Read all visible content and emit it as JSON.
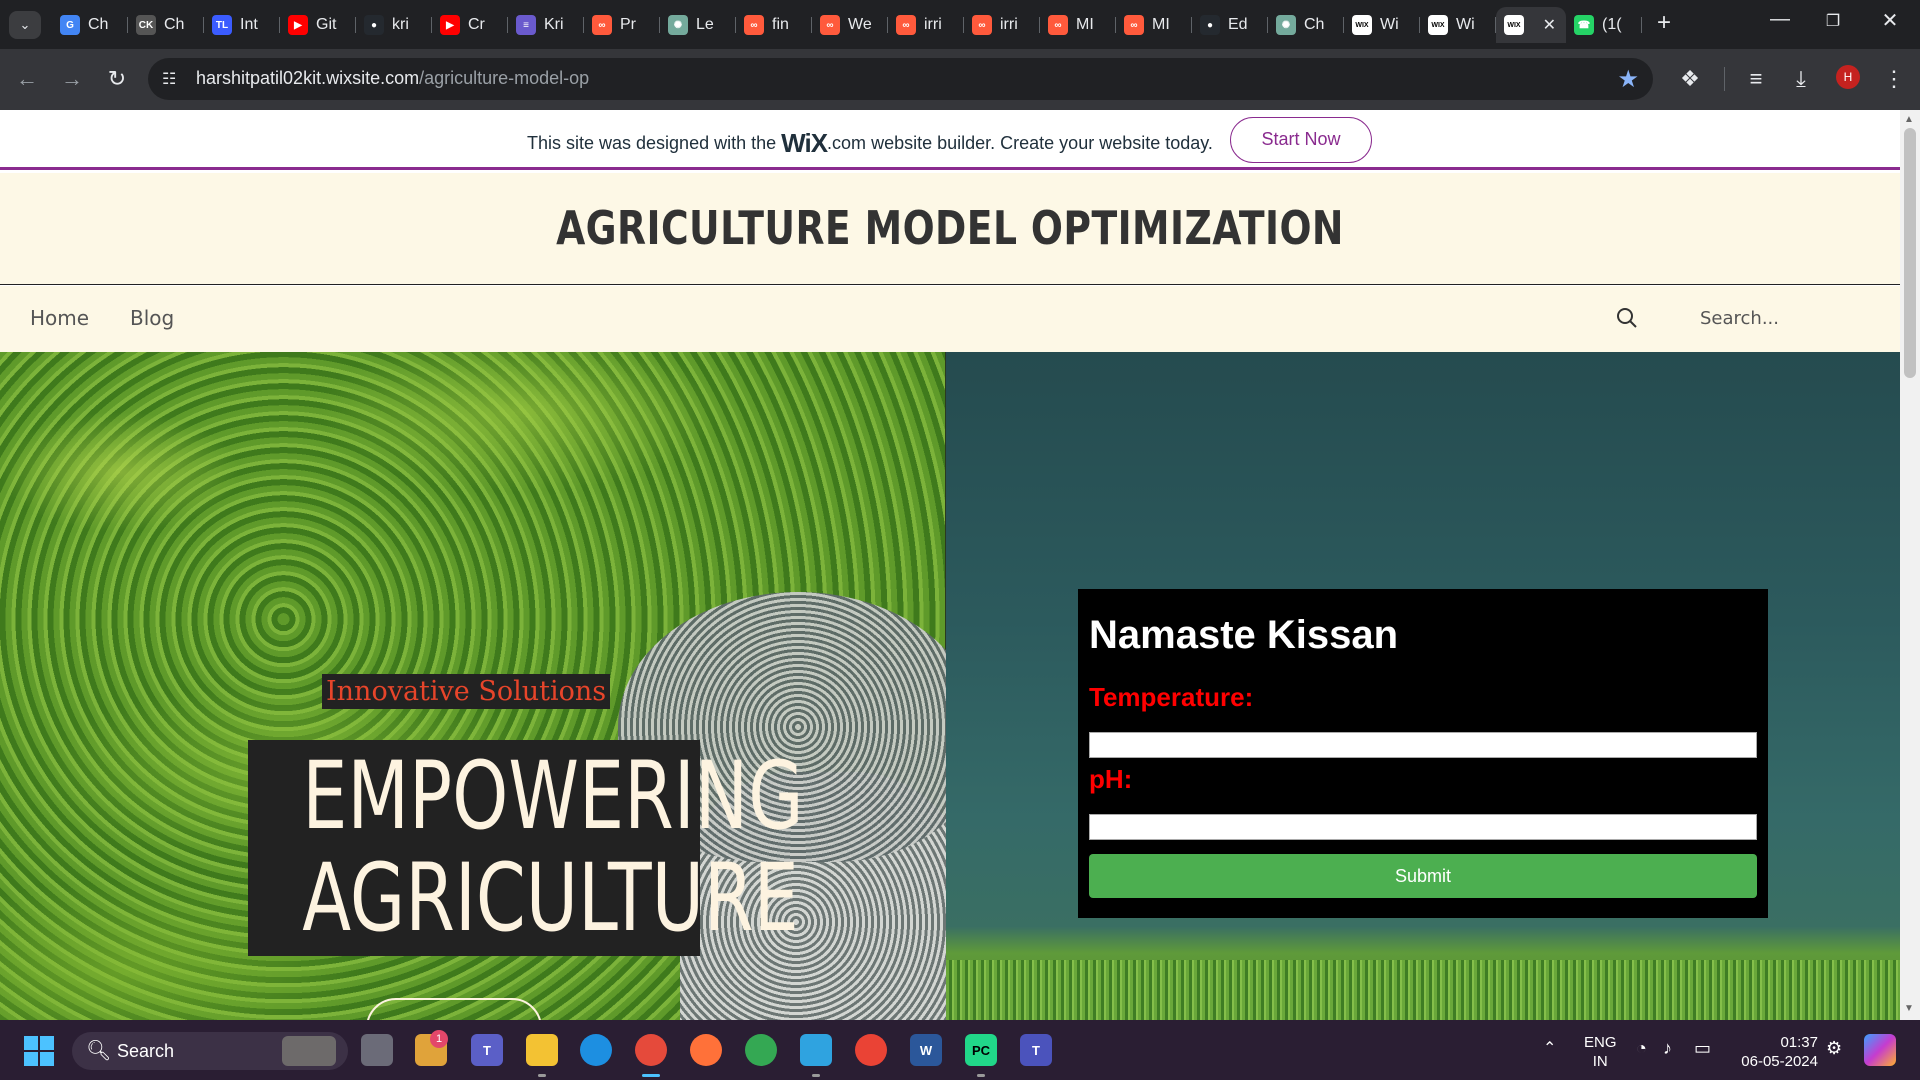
{
  "browser": {
    "tabs": [
      {
        "title": "Ch",
        "icon": "google-icon",
        "color": "#4285f4"
      },
      {
        "title": "Ch",
        "icon": "ck-icon",
        "color": "#555555"
      },
      {
        "title": "Int",
        "icon": "tl-icon",
        "color": "#3b5cff"
      },
      {
        "title": "Git",
        "icon": "youtube-icon",
        "color": "#ff0000"
      },
      {
        "title": "kri",
        "icon": "github-icon",
        "color": "#24292f"
      },
      {
        "title": "Cr",
        "icon": "youtube-icon",
        "color": "#ff0000"
      },
      {
        "title": "Kri",
        "icon": "notes-icon",
        "color": "#6a5acd"
      },
      {
        "title": "Pr",
        "icon": "coursera-icon",
        "color": "#ff5a3c"
      },
      {
        "title": "Le",
        "icon": "chatgpt-icon",
        "color": "#74aa9c"
      },
      {
        "title": "fin",
        "icon": "coursera-icon",
        "color": "#ff5a3c"
      },
      {
        "title": "We",
        "icon": "coursera-icon",
        "color": "#ff5a3c"
      },
      {
        "title": "irri",
        "icon": "coursera-icon",
        "color": "#ff5a3c"
      },
      {
        "title": "irri",
        "icon": "coursera-icon",
        "color": "#ff5a3c"
      },
      {
        "title": "MI",
        "icon": "coursera-icon",
        "color": "#ff5a3c"
      },
      {
        "title": "MI",
        "icon": "coursera-icon",
        "color": "#ff5a3c"
      },
      {
        "title": "Ed",
        "icon": "github-icon",
        "color": "#24292f"
      },
      {
        "title": "Ch",
        "icon": "chatgpt-icon",
        "color": "#74aa9c"
      },
      {
        "title": "Wi",
        "icon": "wix-icon",
        "color": "#ffffff"
      },
      {
        "title": "Wi",
        "icon": "wix-icon",
        "color": "#ffffff"
      }
    ],
    "active_tab": {
      "title": "",
      "icon": "wix-icon"
    },
    "whatsapp_tab": {
      "title": "(1(",
      "icon": "whatsapp-icon",
      "color": "#25d366"
    },
    "url_host": "harshitpatil02kit.wixsite.com",
    "url_path": "/agriculture-model-op",
    "profile_initial": "H"
  },
  "wix_banner": {
    "text_before": "This site was designed with the",
    "logo_text": "WiX",
    "logo_suffix": ".com",
    "text_after": "website builder. Create your website today.",
    "cta": "Start Now",
    "accent_color": "#8a2b8f"
  },
  "site": {
    "title": "AGRICULTURE MODEL OPTIMIZATION",
    "nav": [
      "Home",
      "Blog"
    ],
    "search_placeholder": "Search..."
  },
  "hero": {
    "tagline": "Innovative Solutions",
    "title_line1": "EMPOWERING",
    "title_line2": "AGRICULTURE"
  },
  "form": {
    "heading": "Namaste Kissan",
    "fields": [
      {
        "label": "Temperature:",
        "value": ""
      },
      {
        "label": "pH:",
        "value": ""
      }
    ],
    "submit": "Submit",
    "submit_color": "#4caf50",
    "label_color": "#ff0000"
  },
  "taskbar": {
    "search_label": "Search",
    "notification_count": "1",
    "language_line1": "ENG",
    "language_line2": "IN",
    "time": "01:37",
    "date": "06-05-2024"
  }
}
